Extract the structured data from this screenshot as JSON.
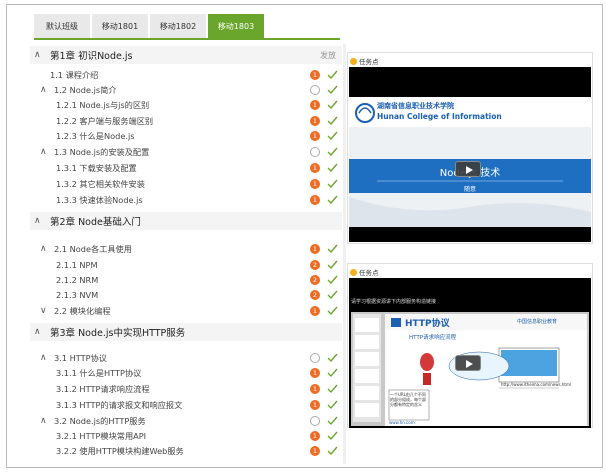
{
  "tabs": [
    {
      "label": "默认班级",
      "active": false
    },
    {
      "label": "移动1801",
      "active": false
    },
    {
      "label": "移动1802",
      "active": false
    },
    {
      "label": "移动1803",
      "active": true
    }
  ],
  "publish_label": "发放",
  "outline": [
    {
      "type": "chapter",
      "caret": "∧",
      "title": "第1章 初识Node.js",
      "publish": true
    },
    {
      "type": "item",
      "title": "1.1  课程介绍",
      "status": "badge",
      "badge": "1"
    },
    {
      "type": "section",
      "caret": "∧",
      "title": "1.2  Node.js简介",
      "status": "circle"
    },
    {
      "type": "sub",
      "title": "1.2.1 Node.js与js的区别",
      "status": "badge",
      "badge": "1"
    },
    {
      "type": "sub",
      "title": "1.2.2 客户端与服务端区别",
      "status": "badge",
      "badge": "1"
    },
    {
      "type": "sub",
      "title": "1.2.3 什么是Node.js",
      "status": "badge",
      "badge": "1"
    },
    {
      "type": "section",
      "caret": "∧",
      "title": "1.3  Node.js的安装及配置",
      "status": "circle"
    },
    {
      "type": "sub",
      "title": "1.3.1 下载安装及配置",
      "status": "badge",
      "badge": "1"
    },
    {
      "type": "sub",
      "title": "1.3.2 其它相关软件安装",
      "status": "badge",
      "badge": "1"
    },
    {
      "type": "sub",
      "title": "1.3.3 快速体验Node.js",
      "status": "badge",
      "badge": "1"
    },
    {
      "type": "chapter",
      "caret": "∧",
      "title": "第2章 Node基础入门",
      "publish": false
    },
    {
      "type": "section",
      "caret": "∧",
      "title": "2.1  Node各工具使用",
      "status": "badge",
      "badge": "1"
    },
    {
      "type": "sub",
      "title": "2.1.1 NPM",
      "status": "badge",
      "badge": "2"
    },
    {
      "type": "sub",
      "title": "2.1.2 NRM",
      "status": "badge",
      "badge": "2"
    },
    {
      "type": "sub",
      "title": "2.1.3 NVM",
      "status": "badge",
      "badge": "2"
    },
    {
      "type": "section",
      "caret": "∨",
      "title": "2.2  模块化编程",
      "status": "badge",
      "badge": "1"
    },
    {
      "type": "chapter",
      "caret": "∧",
      "title": "第3章 Node.js中实现HTTP服务",
      "publish": false
    },
    {
      "type": "section",
      "caret": "∧",
      "title": "3.1  HTTP协议",
      "status": "circle"
    },
    {
      "type": "sub",
      "title": "3.1.1 什么是HTTP协议",
      "status": "badge",
      "badge": "1"
    },
    {
      "type": "sub",
      "title": "3.1.2 HTTP请求响应流程",
      "status": "badge",
      "badge": "1"
    },
    {
      "type": "sub",
      "title": "3.1.3 HTTP的请求报文和响应报文",
      "status": "badge",
      "badge": "1"
    },
    {
      "type": "section",
      "caret": "∧",
      "title": "3.2  Node.js的HTTP服务",
      "status": "circle"
    },
    {
      "type": "sub",
      "title": "3.2.1 HTTP模块常用API",
      "status": "badge",
      "badge": "1"
    },
    {
      "type": "sub",
      "title": "3.2.2 使用HTTP模块构建Web服务",
      "status": "badge",
      "badge": "1"
    }
  ],
  "panel1": {
    "label": "任务点",
    "school_cn": "湖南省信息职业技术学院",
    "school_en": "Hunan College of Information",
    "slide_title": "Node.js  技术",
    "slide_sub": "随意"
  },
  "panel2": {
    "label": "任务点",
    "header_text": "请学习根据资源讲下内部服务构造链接",
    "slide_title": "HTTP协议",
    "org": "中国信息职业教育",
    "bullet": "HTTP请求响应流程",
    "callout": "一个URL由几个不同的部分组成，每个部分都有特定的含义",
    "url": "http://www.itheima.com/news.html",
    "footer": "www.hn.com"
  },
  "colors": {
    "accent": "#6aa52c",
    "badge": "#ee6b24",
    "check": "#6aa52c"
  }
}
